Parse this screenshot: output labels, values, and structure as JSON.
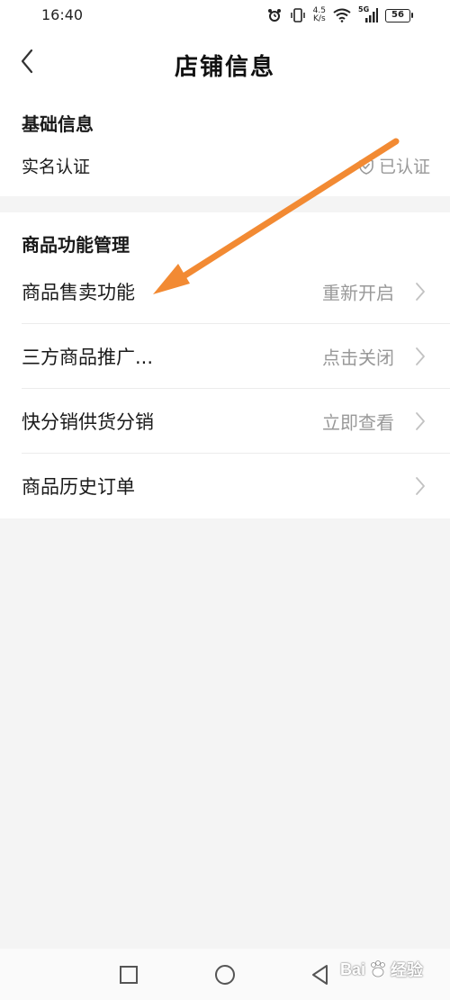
{
  "status_bar": {
    "time": "16:40",
    "net_speed_value": "4.5",
    "net_speed_unit": "K/s",
    "network_type": "5G",
    "battery": "56"
  },
  "header": {
    "title": "店铺信息"
  },
  "basic_info": {
    "section_title": "基础信息",
    "verification_label": "实名认证",
    "verification_status": "已认证"
  },
  "product_management": {
    "section_title": "商品功能管理",
    "rows": [
      {
        "label": "商品售卖功能",
        "value": "重新开启"
      },
      {
        "label": "三方商品推广...",
        "value": "点击关闭"
      },
      {
        "label": "快分销供货分销",
        "value": "立即查看"
      },
      {
        "label": "商品历史订单",
        "value": ""
      }
    ]
  },
  "watermark": {
    "text": "Bai",
    "suffix": "经验"
  },
  "colors": {
    "arrow": "#f28a33",
    "secondary_text": "#999999",
    "background": "#f4f4f4"
  }
}
